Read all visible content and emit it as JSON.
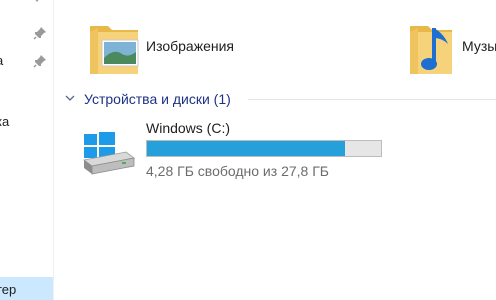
{
  "nav": {
    "items": [
      {
        "label": "а"
      },
      {
        "label": "ка"
      }
    ],
    "selected_label": "тер"
  },
  "folders": [
    {
      "label": "Изображения",
      "icon": "pictures-folder-icon"
    },
    {
      "label": "Музы",
      "icon": "music-folder-icon"
    }
  ],
  "group": {
    "title": "Устройства и диски (1)"
  },
  "drive": {
    "name": "Windows (C:)",
    "free_text": "4,28 ГБ свободно из 27,8 ГБ",
    "used_fraction": 0.846,
    "icon": "windows-drive-icon"
  },
  "colors": {
    "accent": "#26a0da",
    "group_title": "#1e3287",
    "selection": "#cce8ff",
    "secondary_text": "#6d6d6d"
  }
}
